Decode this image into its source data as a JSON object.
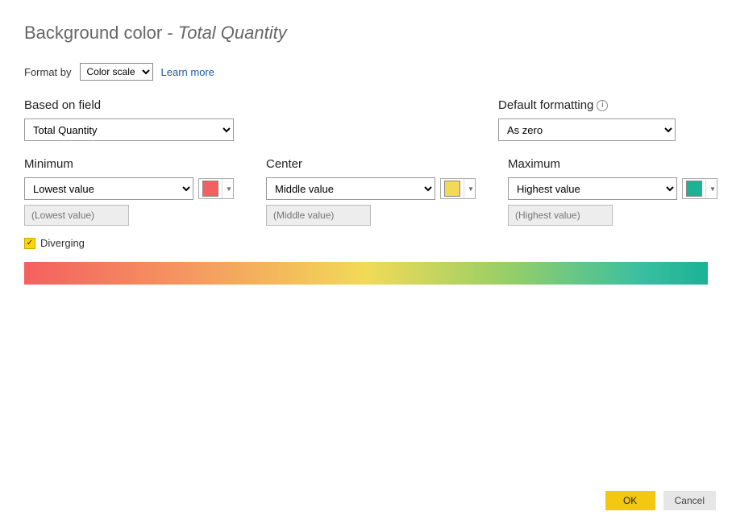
{
  "title_prefix": "Background color",
  "title_context": "Total Quantity",
  "format_by_label": "Format by",
  "format_by_value": "Color scale",
  "learn_more": "Learn more",
  "based_on_field": {
    "label": "Based on field",
    "value": "Total Quantity"
  },
  "default_formatting": {
    "label": "Default formatting",
    "value": "As zero"
  },
  "minimum": {
    "label": "Minimum",
    "value": "Lowest value",
    "placeholder": "(Lowest value)",
    "color": "#f46060"
  },
  "center": {
    "label": "Center",
    "value": "Middle value",
    "placeholder": "(Middle value)",
    "color": "#f2da57"
  },
  "maximum": {
    "label": "Maximum",
    "value": "Highest value",
    "placeholder": "(Highest value)",
    "color": "#1bb295"
  },
  "diverging_label": "Diverging",
  "diverging_checked": true,
  "buttons": {
    "ok": "OK",
    "cancel": "Cancel"
  }
}
